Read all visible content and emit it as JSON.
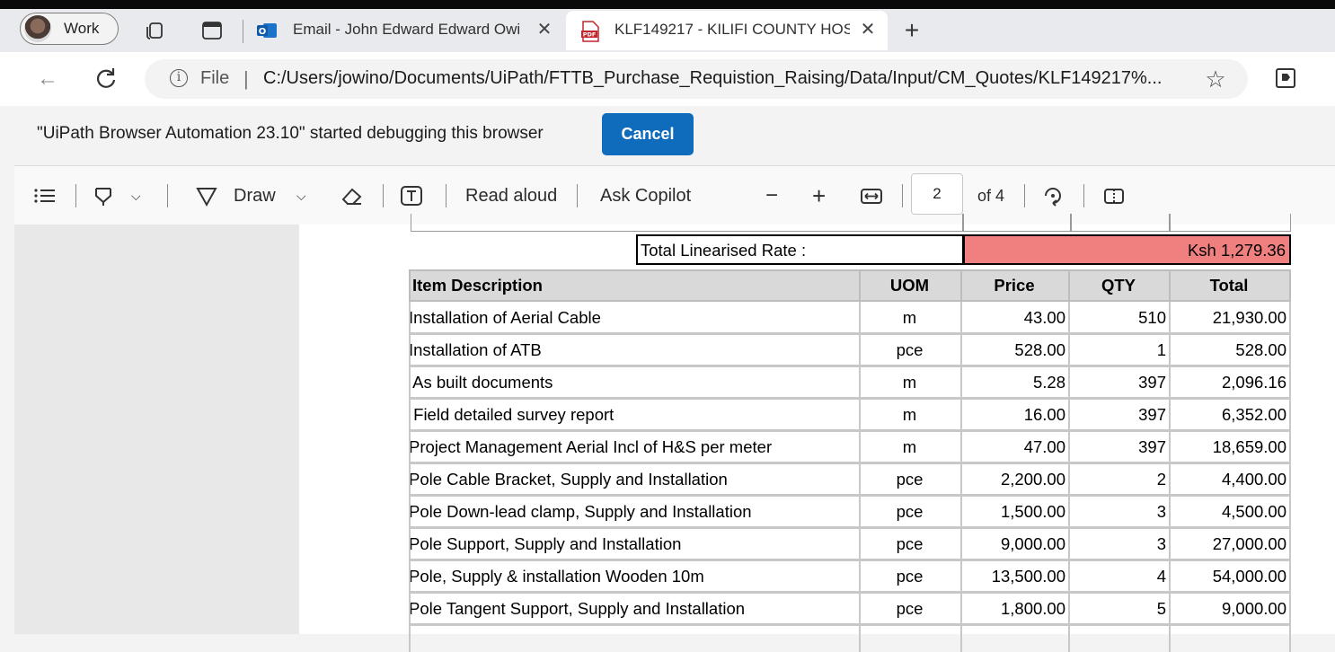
{
  "browser": {
    "profile_label": "Work",
    "tabs": [
      {
        "title": "Email - John Edward Edward Owi"
      },
      {
        "title": "KLF149217 - KILIFI COUNTY HOS"
      }
    ],
    "address": {
      "scheme": "File",
      "url": "C:/Users/jowino/Documents/UiPath/FTTB_Purchase_Requistion_Raising/Data/Input/CM_Quotes/KLF149217%..."
    },
    "infobar": {
      "message": "\"UiPath Browser Automation 23.10\" started debugging this browser",
      "cancel_label": "Cancel"
    }
  },
  "pdf_toolbar": {
    "draw_label": "Draw",
    "read_aloud_label": "Read aloud",
    "ask_copilot_label": "Ask Copilot",
    "page_current": "2",
    "page_total_label": "of 4"
  },
  "document": {
    "linearised_label": "Total Linearised Rate :",
    "linearised_value": "Ksh 1,279.36",
    "table": {
      "headers": [
        "Item Description",
        "UOM",
        "Price",
        "QTY",
        "Total"
      ],
      "rows": [
        [
          "Installation of Aerial Cable",
          "m",
          "43.00",
          "510",
          "21,930.00"
        ],
        [
          "Installation of ATB",
          "pce",
          "528.00",
          "1",
          "528.00"
        ],
        [
          " As built documents",
          "m",
          "5.28",
          "397",
          "2,096.16"
        ],
        [
          " Field detailed survey report",
          "m",
          "16.00",
          "397",
          "6,352.00"
        ],
        [
          "Project Management Aerial Incl of H&S per meter",
          "m",
          "47.00",
          "397",
          "18,659.00"
        ],
        [
          "Pole Cable Bracket, Supply and Installation",
          "pce",
          "2,200.00",
          "2",
          "4,400.00"
        ],
        [
          "Pole Down-lead clamp, Supply and Installation",
          "pce",
          "1,500.00",
          "3",
          "4,500.00"
        ],
        [
          "Pole Support, Supply and Installation",
          "pce",
          "9,000.00",
          "3",
          "27,000.00"
        ],
        [
          "Pole, Supply & installation Wooden 10m",
          "pce",
          "13,500.00",
          "4",
          "54,000.00"
        ],
        [
          "Pole Tangent Support, Supply and Installation",
          "pce",
          "1,800.00",
          "5",
          "9,000.00"
        ]
      ]
    }
  },
  "colors": {
    "highlight_red": "#f08080",
    "accent_blue": "#0f6cbd"
  }
}
